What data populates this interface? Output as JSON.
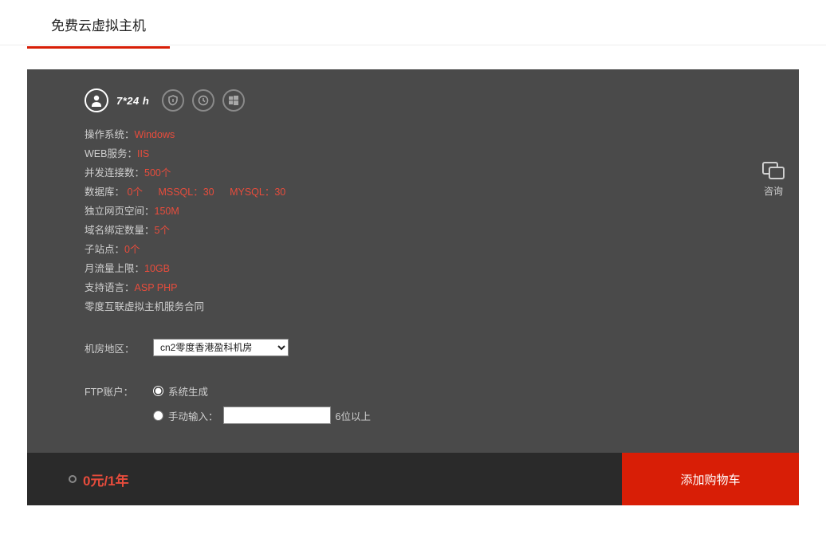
{
  "tab": {
    "title": "免费云虚拟主机"
  },
  "icons": {
    "hours": "7*24 h"
  },
  "specs": {
    "os_label": "操作系统：",
    "os_value": "Windows",
    "web_label": "WEB服务：",
    "web_value": "IIS",
    "conn_label": "并发连接数：",
    "conn_value": "500个",
    "db_label": "数据库：",
    "db_v1": "0个",
    "db_v2": "MSSQL：30",
    "db_v3": "MYSQL：30",
    "space_label": "独立网页空间：",
    "space_value": "150M",
    "domain_label": "域名绑定数量：",
    "domain_value": "5个",
    "sub_label": "子站点：",
    "sub_value": "0个",
    "flow_label": "月流量上限：",
    "flow_value": "10GB",
    "lang_label": "支持语言：",
    "lang_value": "ASP PHP",
    "contract": "零度互联虚拟主机服务合同"
  },
  "region": {
    "label": "机房地区：",
    "selected": "cn2零度香港盈科机房"
  },
  "ftp": {
    "label": "FTP账户：",
    "opt_auto": "系统生成",
    "opt_manual": "手动输入：",
    "hint": "6位以上"
  },
  "consult": {
    "label": "咨询"
  },
  "footer": {
    "price": "0元/1年",
    "cart": "添加购物车"
  }
}
